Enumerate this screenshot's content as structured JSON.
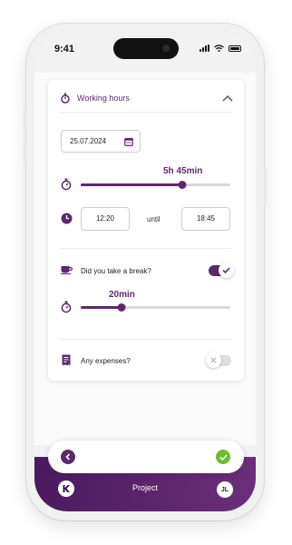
{
  "status_bar": {
    "time": "9:41"
  },
  "card": {
    "title": "Working hours",
    "date": "25.07.2024",
    "work_duration": "5h 45min",
    "work_slider_fraction": 0.68,
    "start_time": "12:20",
    "until_label": "until",
    "end_time": "18:45",
    "break_question": "Did you take a break?",
    "break_toggle_on": true,
    "break_duration": "20min",
    "break_slider_fraction": 0.27,
    "expenses_label": "Any expenses?",
    "expenses_toggle_on": false
  },
  "bottom_nav": {
    "title": "Project",
    "avatar_initials": "JL",
    "logo_letter": "K"
  },
  "colors": {
    "accent": "#5c2a6c",
    "success": "#6abf2a"
  },
  "icons": [
    "stopwatch-icon",
    "chevron-up-icon",
    "calendar-icon",
    "clock-icon",
    "coffee-cup-icon",
    "receipt-icon",
    "check-icon",
    "close-icon",
    "back-arrow-icon"
  ]
}
